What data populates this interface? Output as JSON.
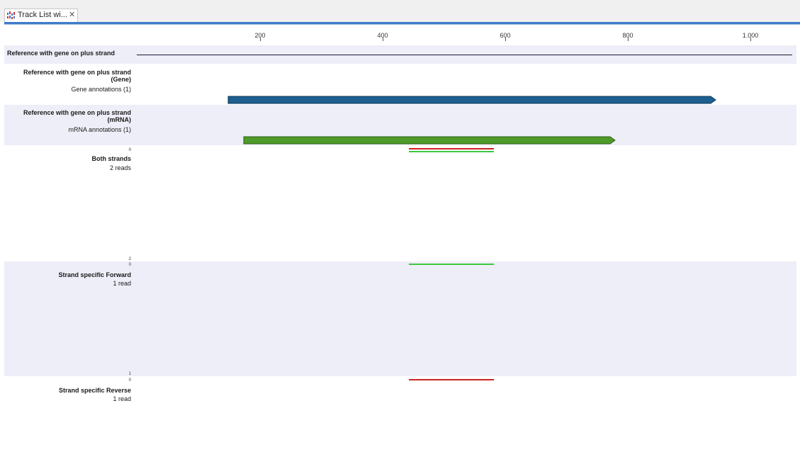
{
  "tab": {
    "title": "Track List wi...",
    "close": "✕",
    "icon": "track-list-icon"
  },
  "ruler": {
    "labels": [
      "200",
      "400",
      "600",
      "800",
      "1.000"
    ]
  },
  "tracks": {
    "reference": {
      "label": "Reference with gene on plus strand"
    },
    "gene": {
      "label_line1": "Reference with gene on plus strand",
      "label_line2": "(Gene)",
      "sublabel": "Gene annotations (1)",
      "color": "#1d5f8e"
    },
    "mrna": {
      "label_line1": "Reference with gene on plus strand",
      "label_line2": "(mRNA)",
      "sublabel": "mRNA annotations (1)",
      "color": "#4e9a2a"
    },
    "both": {
      "title": "Both strands",
      "reads": "2 reads",
      "axis_top": "0",
      "axis_bottom": "2"
    },
    "forward": {
      "title": "Strand specific Forward",
      "reads": "1 read",
      "axis_top": "0",
      "axis_bottom": "1"
    },
    "reverse": {
      "title": "Strand specific Reverse",
      "reads": "1 read",
      "axis_top": "0"
    }
  },
  "colors": {
    "forward_read": "#3cc83c",
    "reverse_read": "#cc2222",
    "band": "#eeeef8",
    "accent": "#3f7bc9"
  }
}
